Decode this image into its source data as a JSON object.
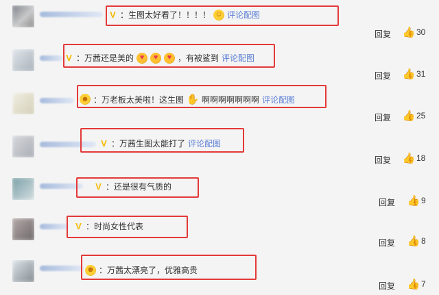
{
  "comments": [
    {
      "text": "：生图太好看了！！！！",
      "emoji": "smile-icon",
      "link": "评论配图",
      "reply": "回复",
      "likes": "30"
    },
    {
      "text": "：万茜还是美的",
      "emoji": "heart-eyes-icon",
      "after": "，有被鲨到",
      "link": "评论配图",
      "reply": "回复",
      "likes": "31"
    },
    {
      "text": "：万老板太美啦！这生图",
      "emoji": "hand-icon",
      "after": "啊啊啊啊啊啊啊",
      "link": "评论配图",
      "reply": "回复",
      "likes": "25"
    },
    {
      "text": "：万茜生图太能打了",
      "link": "评论配图",
      "reply": "回复",
      "likes": "18"
    },
    {
      "text": "：还是很有气质的",
      "reply": "回复",
      "likes": "9"
    },
    {
      "text": "：时尚女性代表",
      "reply": "回复",
      "likes": "8"
    },
    {
      "text": "：万茜太漂亮了，优雅高贵",
      "reply": "回复",
      "likes": "7"
    }
  ],
  "colors": {
    "highlight": "#e43838",
    "link": "#5b7ed4",
    "vip": "#f4b900",
    "background": "#f4f4f4"
  }
}
